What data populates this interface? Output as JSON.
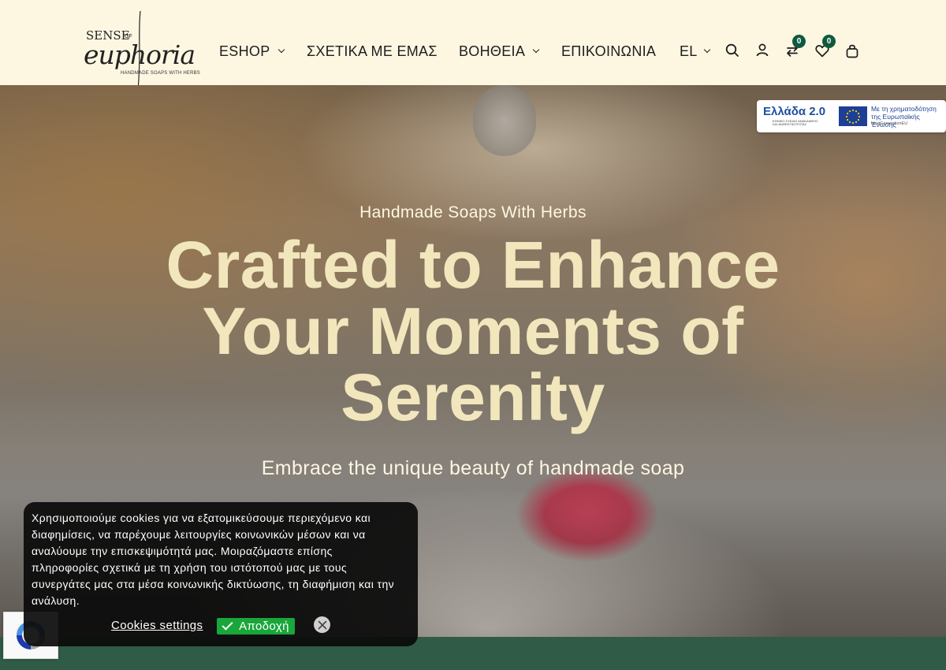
{
  "header": {
    "logo": {
      "line1": "SENSE",
      "line1_small": "OF",
      "script": "euphoria",
      "tagline": "HANDMADE SOAPS WITH HERBS"
    },
    "nav": [
      {
        "label": "ESHOP",
        "has_dropdown": true
      },
      {
        "label": "ΣΧΕΤΙΚΑ ΜΕ ΕΜΑΣ",
        "has_dropdown": false
      },
      {
        "label": "ΒΟΗΘΕΙΑ",
        "has_dropdown": true
      },
      {
        "label": "ΕΠΙΚΟΙΝΩΝΙΑ",
        "has_dropdown": false
      },
      {
        "label": "EL",
        "has_dropdown": true
      }
    ],
    "icons": {
      "search": "search-icon",
      "account": "user-icon",
      "compare": "compare-icon",
      "compare_count": "0",
      "wishlist": "heart-icon",
      "wishlist_count": "0",
      "cart": "bag-icon"
    }
  },
  "eu_banner": {
    "greece_title": "Ελλάδα 2.0",
    "greece_subtitle": "ΕΘΝΙΚΟ ΣΧΕΔΙΟ ΑΝΑΚΑΜΨΗΣ ΚΑΙ ΑΝΘΕΚΤΙΚΟΤΗΤΑΣ",
    "eu_text": "Με τη χρηματοδότηση της Ευρωπαϊκής Ένωσης",
    "eu_small": "NextGenerationEU"
  },
  "hero": {
    "eyebrow": "Handmade Soaps With Herbs",
    "headline": "Crafted to Enhance Your Moments of Serenity",
    "subheadline": "Embrace the unique beauty of handmade soap"
  },
  "cookie": {
    "message": "Χρησιμοποιούμε cookies για να εξατομικεύσουμε περιεχόμενο και διαφημίσεις, να παρέχουμε λειτουργίες κοινωνικών μέσων και να αναλύουμε την επισκεψιμότητά μας. Μοιραζόμαστε επίσης πληροφορίες σχετικά με τη χρήση του ιστότοπού μας με τους συνεργάτες μας στα μέσα κοινωνικής δικτύωσης, τη διαφήμιση και την ανάλυση.",
    "settings_label": "Cookies settings",
    "accept_label": "Αποδοχή"
  },
  "colors": {
    "header_bg": "#fdf7e2",
    "headline": "#f2e6bd",
    "badge": "#0f5a3f",
    "bottom_bar": "#2f5b47",
    "accept": "#19a63a"
  }
}
